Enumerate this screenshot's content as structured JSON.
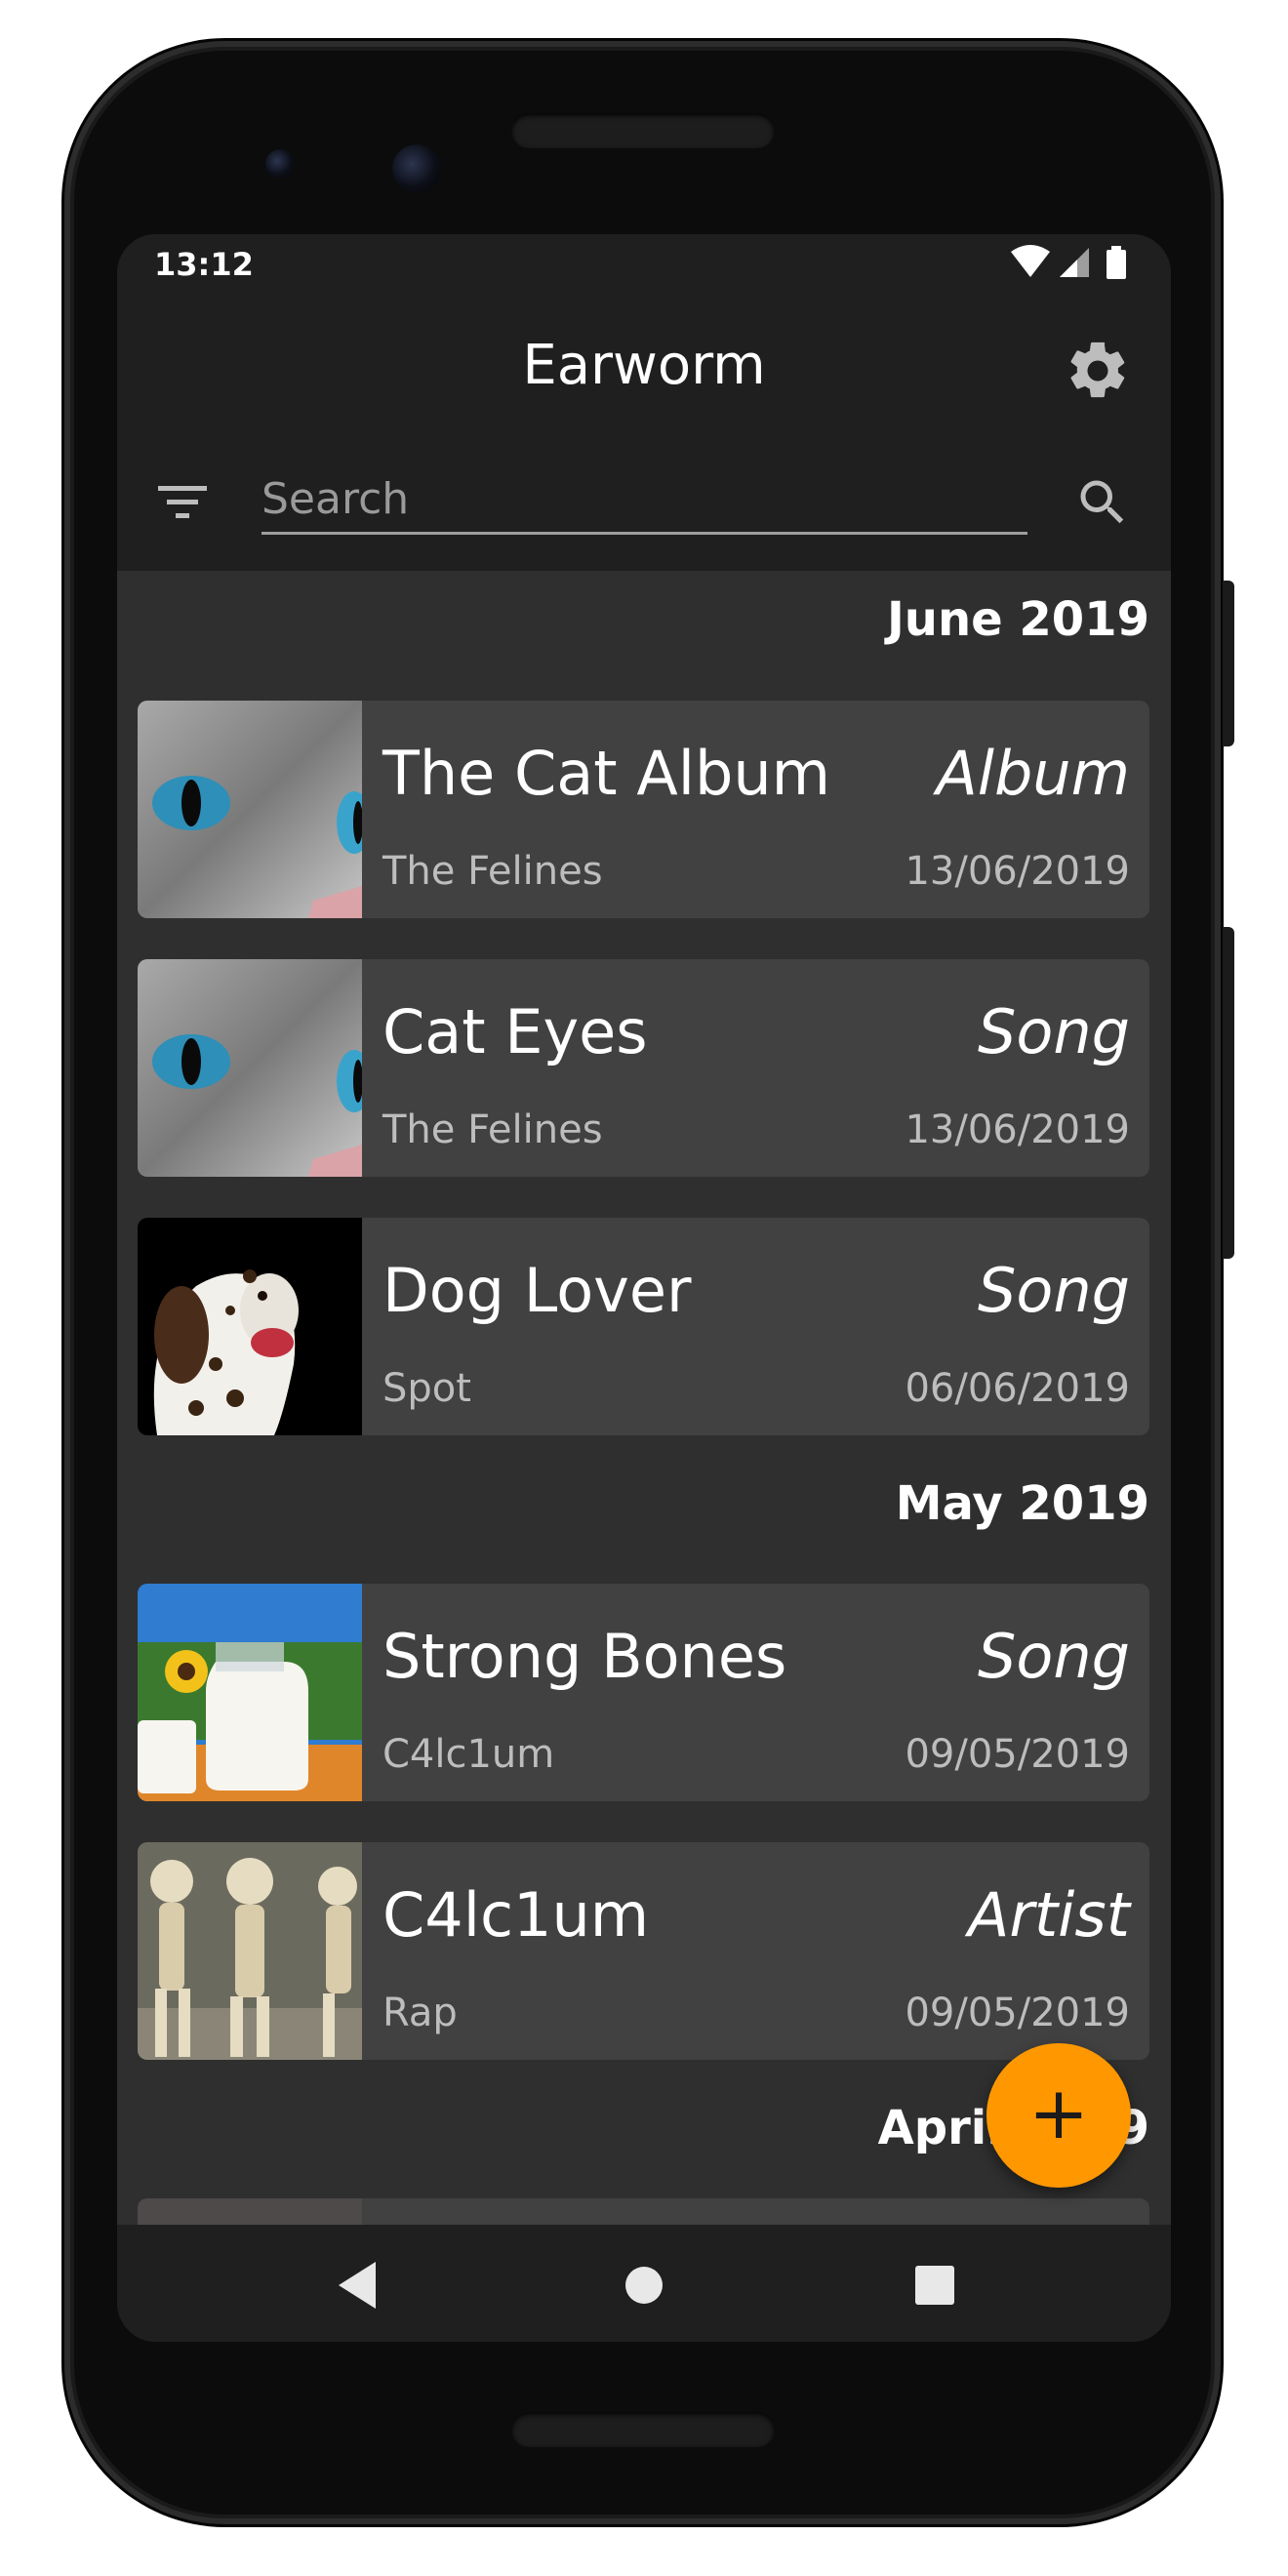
{
  "status_bar": {
    "time": "13:12",
    "icons": [
      "wifi-icon",
      "signal-icon",
      "battery-icon"
    ]
  },
  "app_bar": {
    "title": "Earworm",
    "settings_icon": "gear-icon"
  },
  "search": {
    "placeholder": "Search",
    "value": "",
    "filter_icon": "filter-icon",
    "search_icon": "search-icon"
  },
  "sections": [
    {
      "header": "June 2019",
      "items": [
        {
          "title": "The Cat Album",
          "kind": "Album",
          "subtitle": "The Felines",
          "date": "13/06/2019",
          "thumbnail": "cat-eyes-photo"
        },
        {
          "title": "Cat Eyes",
          "kind": "Song",
          "subtitle": "The Felines",
          "date": "13/06/2019",
          "thumbnail": "cat-eyes-photo"
        },
        {
          "title": "Dog Lover",
          "kind": "Song",
          "subtitle": "Spot",
          "date": "06/06/2019",
          "thumbnail": "dalmatian-photo"
        }
      ]
    },
    {
      "header": "May 2019",
      "items": [
        {
          "title": "Strong Bones",
          "kind": "Song",
          "subtitle": "C4lc1um",
          "date": "09/05/2019",
          "thumbnail": "milk-photo"
        },
        {
          "title": "C4lc1um",
          "kind": "Artist",
          "subtitle": "Rap",
          "date": "09/05/2019",
          "thumbnail": "skeletons-photo"
        }
      ]
    },
    {
      "header": "April 2019",
      "items": []
    }
  ],
  "fab": {
    "label": "+",
    "icon": "add-icon"
  },
  "nav_bar": {
    "icons": [
      "back-icon",
      "home-icon",
      "recents-icon"
    ]
  },
  "colors": {
    "accent": "#ff9800",
    "background": "#2f2f2f",
    "card": "#414141",
    "bar": "#1f1f1f"
  }
}
